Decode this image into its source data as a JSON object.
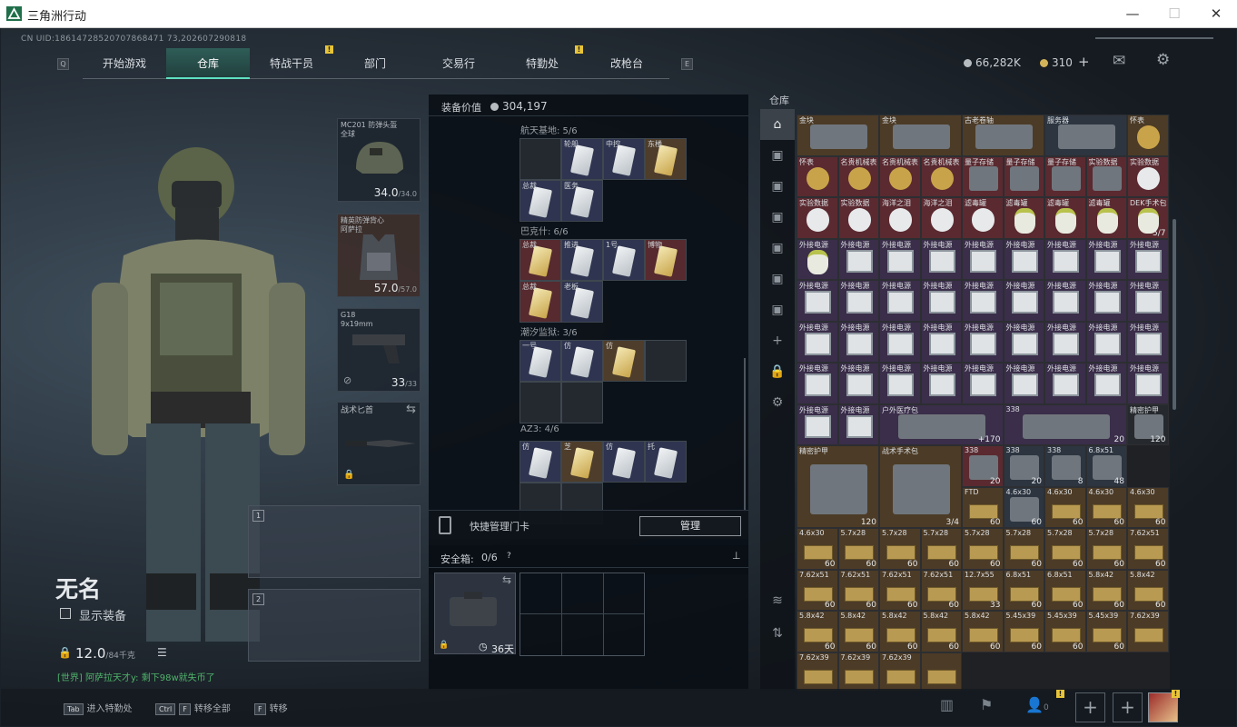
{
  "window": {
    "title": "三角洲行动",
    "minimize": "—",
    "maximize": "☐",
    "close": "✕"
  },
  "uid": "CN UID:18614728520707868471 73,202607290818",
  "nav": {
    "key_left": "Q",
    "key_right": "E",
    "tabs": [
      "开始游戏",
      "仓库",
      "特战干员",
      "部门",
      "交易行",
      "特勤处",
      "改枪台"
    ],
    "selected": "仓库"
  },
  "currency": {
    "silver": "66,282K",
    "gold": "310",
    "plus": "+"
  },
  "loadout": {
    "helmet": {
      "name": "MC201 防弹头盔",
      "sub": "全球",
      "dur": "34.0",
      "max": "/34.0"
    },
    "armor": {
      "name": "精英防弹背心",
      "sub": "阿萨拉",
      "dur": "57.0",
      "max": "/57.0"
    },
    "sidearm": {
      "name": "G18",
      "sub": "9x19mm",
      "ammo": "33",
      "max": "/33"
    },
    "melee": {
      "name": "战术匕首"
    },
    "weapon_slots": [
      "1",
      "2"
    ]
  },
  "player": {
    "name": "无名",
    "show_gear": "显示装备",
    "weight": "12.0",
    "weight_max": "/84千克",
    "chat": "[世界] 阿萨拉天才y: 剩下98w就失币了"
  },
  "equip_panel": {
    "title": "装备价值",
    "value": "304,197"
  },
  "keycards": {
    "sections": [
      {
        "title": "航天基地: 5/6"
      },
      {
        "title": "巴克什: 6/6"
      },
      {
        "title": "潮汐监狱: 3/6"
      },
      {
        "title": "AZ3: 4/6"
      }
    ],
    "labels": [
      "轮船",
      "中控",
      "东楼",
      "总裁",
      "医务",
      "总裁",
      "推进",
      "1号",
      "博物",
      "总裁",
      "老板",
      "一号",
      "仿",
      "仿",
      "仿",
      "芝",
      "仿",
      "托"
    ]
  },
  "quick": {
    "label": "快捷管理门卡",
    "button": "管理"
  },
  "safe": {
    "title": "安全箱:",
    "count": "0/6",
    "help": "?",
    "days": "36天"
  },
  "stash": {
    "title": "仓库",
    "items": [
      {
        "l": "金块",
        "c": ""
      },
      {
        "l": "金块",
        "c": ""
      },
      {
        "l": "古老卷轴",
        "c": ""
      },
      {
        "l": "服务器",
        "c": ""
      },
      {
        "l": "怀表",
        "c": ""
      },
      {
        "l": "怀表",
        "c": ""
      },
      {
        "l": "名贵机械表",
        "c": ""
      },
      {
        "l": "名贵机械表",
        "c": ""
      },
      {
        "l": "名贵机械表",
        "c": ""
      },
      {
        "l": "量子存储",
        "c": ""
      },
      {
        "l": "量子存储",
        "c": ""
      },
      {
        "l": "量子存储",
        "c": ""
      },
      {
        "l": "实验数据",
        "c": ""
      },
      {
        "l": "实验数据",
        "c": ""
      },
      {
        "l": "实验数据",
        "c": ""
      },
      {
        "l": "实验数据",
        "c": ""
      },
      {
        "l": "海洋之泪",
        "c": ""
      },
      {
        "l": "海洋之泪",
        "c": ""
      },
      {
        "l": "滤毒罐",
        "c": ""
      },
      {
        "l": "滤毒罐",
        "c": ""
      },
      {
        "l": "滤毒罐",
        "c": ""
      },
      {
        "l": "滤毒罐",
        "c": ""
      },
      {
        "l": "DEK手术包",
        "c": "5/7"
      },
      {
        "l": "户外医疗包",
        "c": "+170"
      },
      {
        "l": "338",
        "c": "20"
      },
      {
        "l": "精密护甲",
        "c": "120"
      },
      {
        "l": "精密护甲",
        "c": "120"
      },
      {
        "l": "战术手术包",
        "c": "3/4"
      },
      {
        "l": "338",
        "c": "20"
      },
      {
        "l": "338",
        "c": "20"
      },
      {
        "l": "338",
        "c": "8"
      },
      {
        "l": "6.8x51",
        "c": "48"
      },
      {
        "l": "FTD",
        "c": "60"
      },
      {
        "l": "4.6x30",
        "c": "60"
      },
      {
        "l": "4.6x30",
        "c": "60"
      },
      {
        "l": "4.6x30",
        "c": "60"
      },
      {
        "l": "4.6x30",
        "c": "60"
      },
      {
        "l": "4.6x30",
        "c": "60"
      },
      {
        "l": "5.7x28",
        "c": "60"
      },
      {
        "l": "5.7x28",
        "c": "60"
      },
      {
        "l": "5.7x28",
        "c": "60"
      },
      {
        "l": "5.7x28",
        "c": "60"
      },
      {
        "l": "5.7x28",
        "c": "60"
      },
      {
        "l": "5.7x28",
        "c": "60"
      },
      {
        "l": "5.7x28",
        "c": "60"
      },
      {
        "l": "7.62x51",
        "c": "60"
      },
      {
        "l": "7.62x51",
        "c": "60"
      },
      {
        "l": "7.62x51",
        "c": "60"
      },
      {
        "l": "7.62x51",
        "c": "60"
      },
      {
        "l": "7.62x51",
        "c": "60"
      },
      {
        "l": "12.7x55",
        "c": "33"
      },
      {
        "l": "6.8x51",
        "c": "60"
      },
      {
        "l": "6.8x51",
        "c": "60"
      },
      {
        "l": "5.8x42",
        "c": "60"
      },
      {
        "l": "5.8x42",
        "c": "60"
      },
      {
        "l": "5.8x42",
        "c": "60"
      },
      {
        "l": "5.8x42",
        "c": "60"
      },
      {
        "l": "5.8x42",
        "c": "60"
      },
      {
        "l": "5.8x42",
        "c": "60"
      },
      {
        "l": "5.8x42",
        "c": "60"
      },
      {
        "l": "5.45x39",
        "c": "60"
      },
      {
        "l": "5.45x39",
        "c": "60"
      },
      {
        "l": "5.45x39",
        "c": "60"
      },
      {
        "l": "7.62x39",
        "c": ""
      },
      {
        "l": "7.62x39",
        "c": ""
      },
      {
        "l": "7.62x39",
        "c": ""
      },
      {
        "l": "7.62x39",
        "c": ""
      }
    ],
    "battery_label": "外接电源"
  },
  "bottom": {
    "tab_key": "Tab",
    "tab_text": "进入特勤处",
    "ctrlf_key1": "Ctrl",
    "ctrlf_key2": "F",
    "ctrlf_text": "转移全部",
    "f_key": "F",
    "f_text": "转移",
    "friends": "0"
  },
  "colors": {
    "accent": "#5fe0c0",
    "legendary": "#562a2e",
    "epic": "#2f3450",
    "gold": "#4e3d2a",
    "badge": "#e8c437"
  }
}
